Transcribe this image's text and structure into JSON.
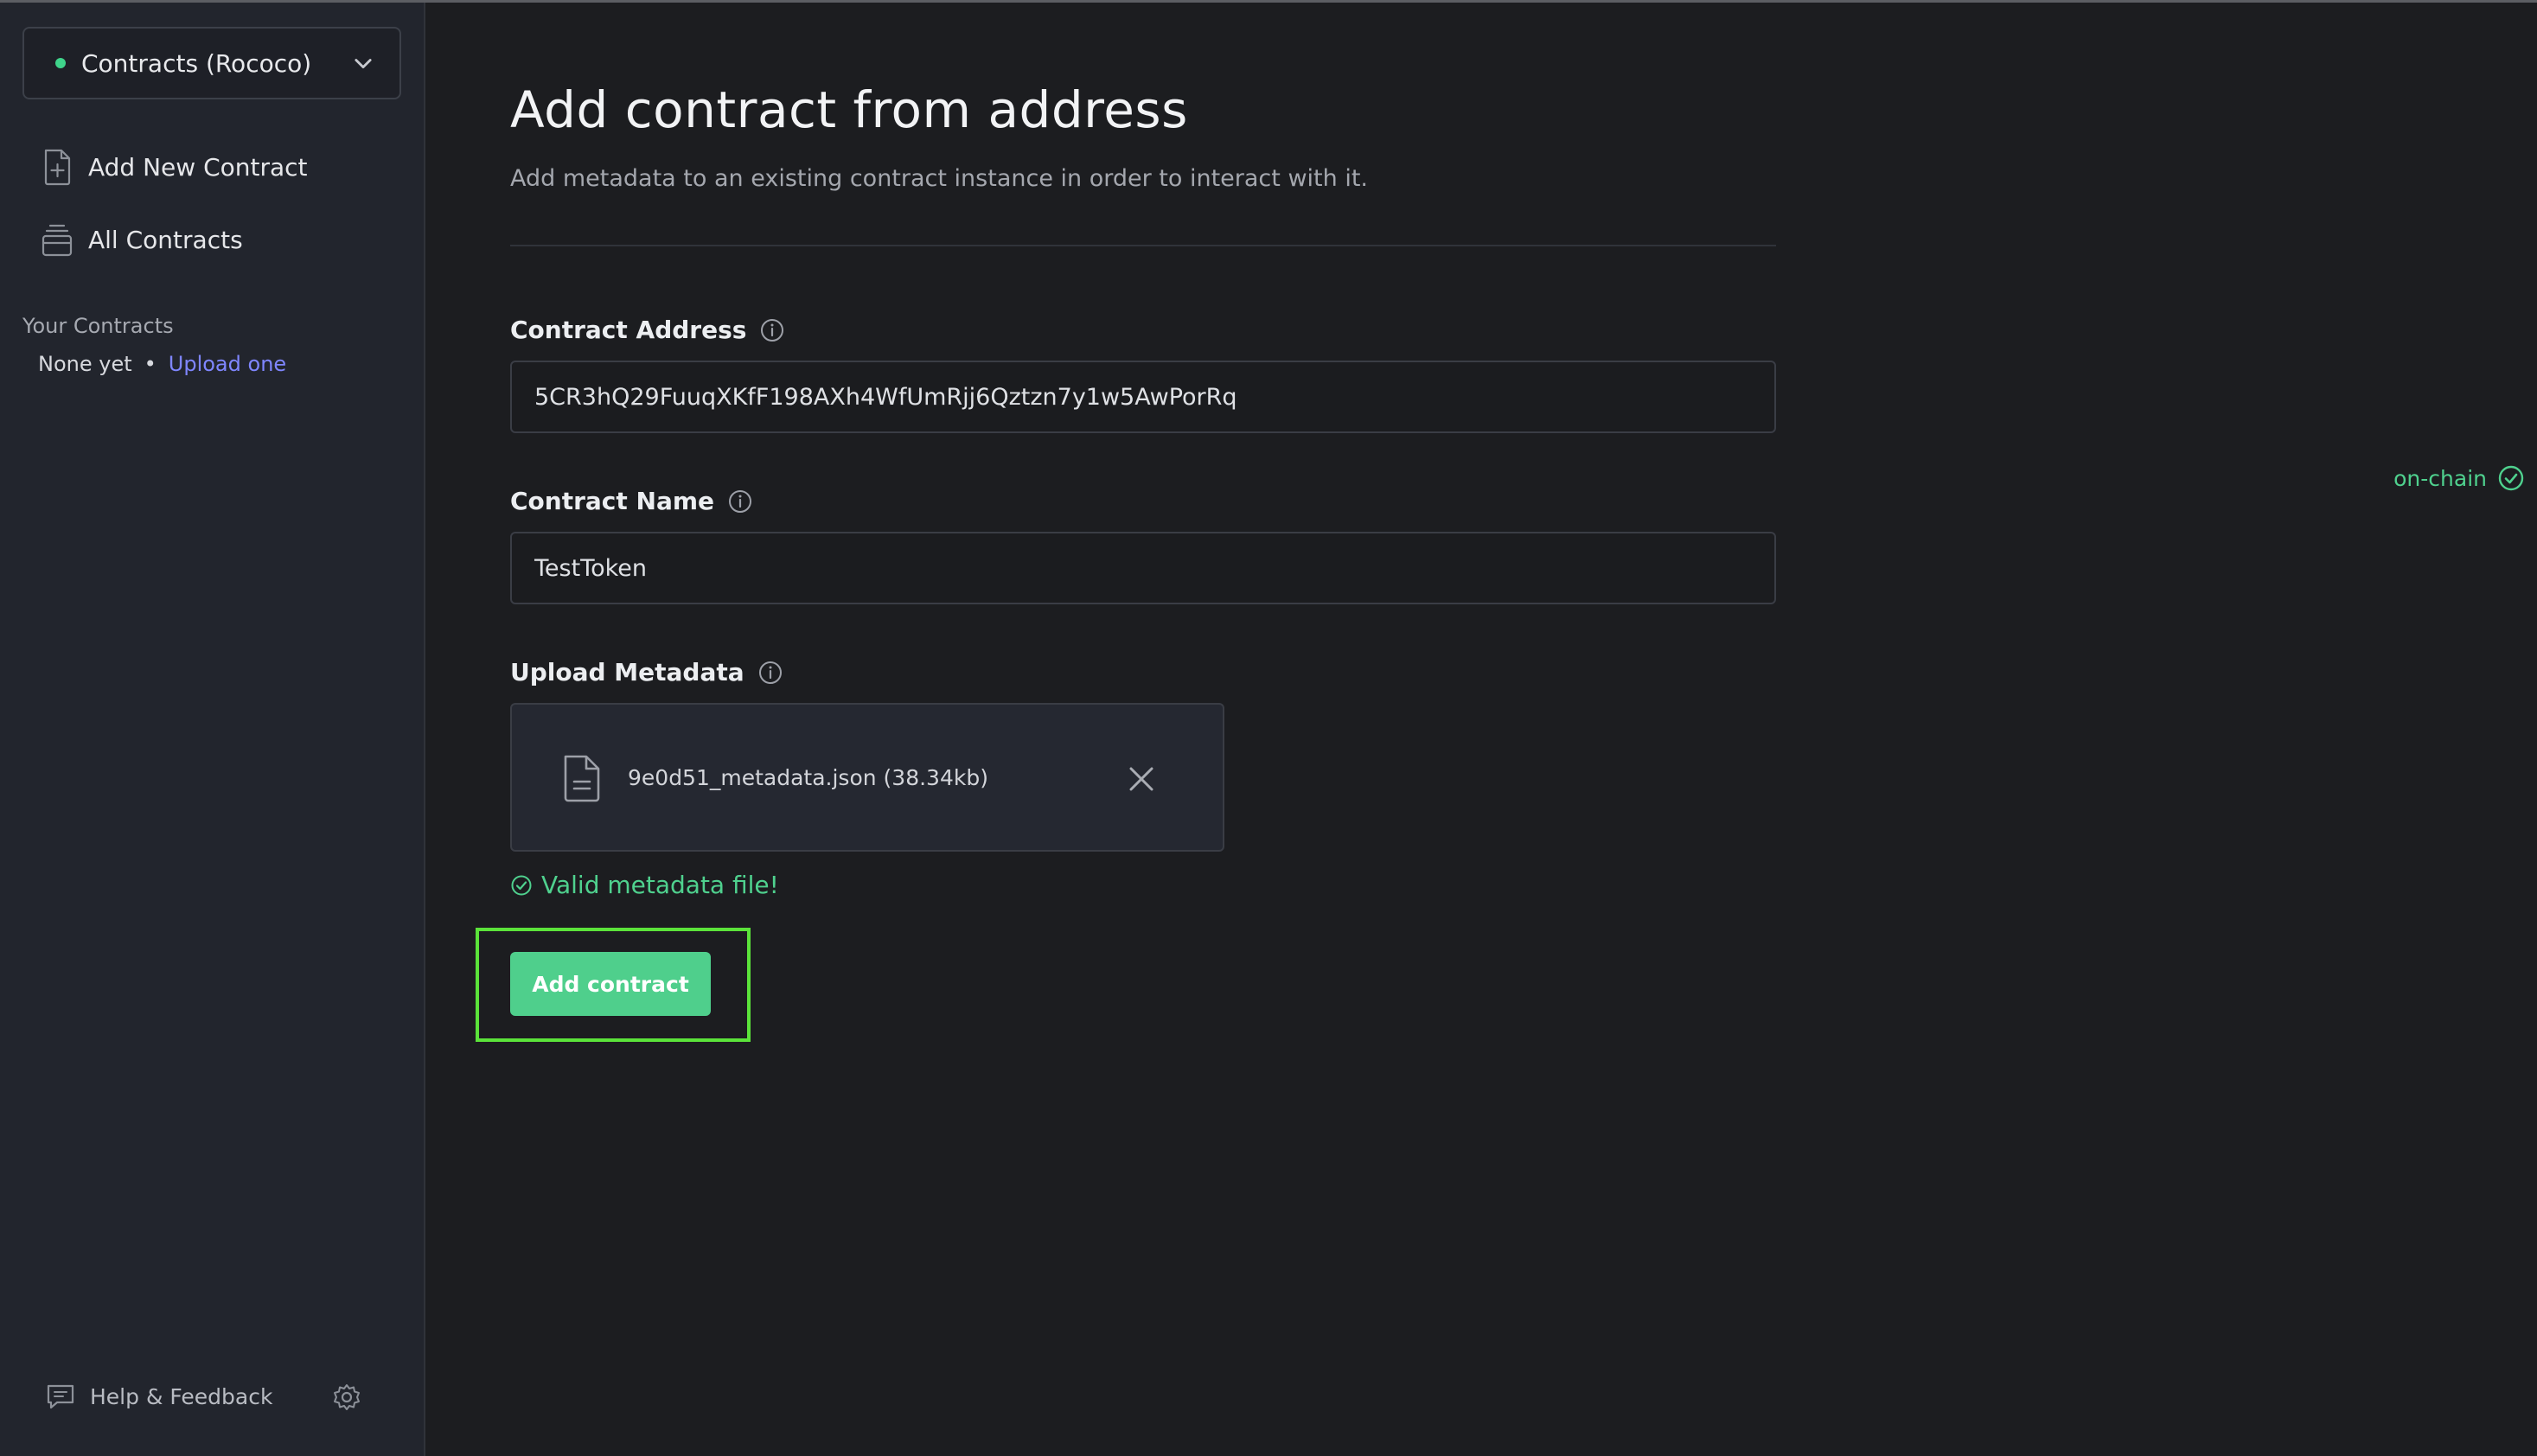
{
  "colors": {
    "accent_green": "#4fcf8c",
    "link_purple": "#7f86ff",
    "highlight": "#5be33a",
    "background": "#1c1d20",
    "sidebar": "#22252d"
  },
  "sidebar": {
    "network_select": {
      "label": "Contracts (Rococo)",
      "status_icon": "green-dot",
      "chevron_icon": "chevron-down-icon"
    },
    "nav": [
      {
        "label": "Add New Contract",
        "icon": "file-plus-icon"
      },
      {
        "label": "All Contracts",
        "icon": "stack-icon"
      }
    ],
    "your_contracts": {
      "heading": "Your Contracts",
      "empty_text": "None yet",
      "separator": "•",
      "upload_link": "Upload one"
    },
    "footer": {
      "help_label": "Help & Feedback",
      "help_icon": "chat-bubble-icon",
      "settings_icon": "gear-icon"
    }
  },
  "main": {
    "title": "Add contract from address",
    "subtitle": "Add metadata to an existing contract instance in order to interact with it.",
    "fields": {
      "address": {
        "label": "Contract Address",
        "value": "5CR3hQ29FuuqXKfF198AXh4WfUmRjj6Qztzn7y1w5AwPorRq"
      },
      "name": {
        "label": "Contract Name",
        "value": "TestToken"
      },
      "metadata": {
        "label": "Upload Metadata",
        "file_name": "9e0d51_metadata.json (38.34kb)",
        "file_icon": "file-text-icon",
        "remove_icon": "close-icon"
      }
    },
    "validation": {
      "text": "Valid metadata file!",
      "icon": "check-circle-icon"
    },
    "submit_label": "Add contract",
    "onchain": {
      "label": "on-chain",
      "icon": "check-circle-icon"
    }
  }
}
